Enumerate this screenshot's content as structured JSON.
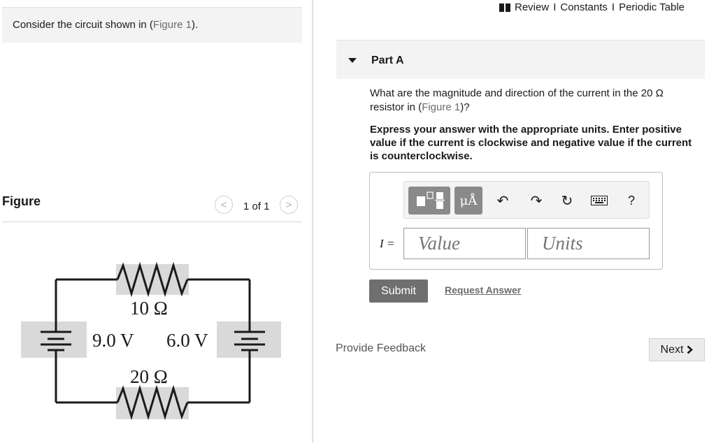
{
  "intro": {
    "text_before": "Consider the circuit shown in (",
    "figure_link": "Figure 1",
    "text_after": ")."
  },
  "figure": {
    "title": "Figure",
    "pager_count": "1 of 1",
    "prev_glyph": "<",
    "next_glyph": ">",
    "circuit": {
      "resistor_top_label": "10 Ω",
      "resistor_bottom_label": "20 Ω",
      "battery_left_label": "9.0 V",
      "battery_right_label": "6.0 V"
    }
  },
  "top_links": {
    "review": "Review",
    "sep1": "I",
    "constants": "Constants",
    "sep2": "I",
    "periodic_table": "Periodic Table"
  },
  "part": {
    "label": "Part A",
    "question_before": "What are the magnitude and direction of the current in the 20 Ω resistor in (",
    "question_link": "Figure 1",
    "question_after": ")?",
    "instructions": "Express your answer with the appropriate units. Enter positive value if the current is clockwise and negative value if the current is counterclockwise."
  },
  "toolbar": {
    "units_button_label": "μÅ",
    "help_label": "?"
  },
  "answer": {
    "variable_label": "I =",
    "value_placeholder": "Value",
    "units_placeholder": "Units"
  },
  "actions": {
    "submit_label": "Submit",
    "request_answer_label": "Request Answer",
    "feedback_label": "Provide Feedback",
    "next_label": "Next"
  }
}
